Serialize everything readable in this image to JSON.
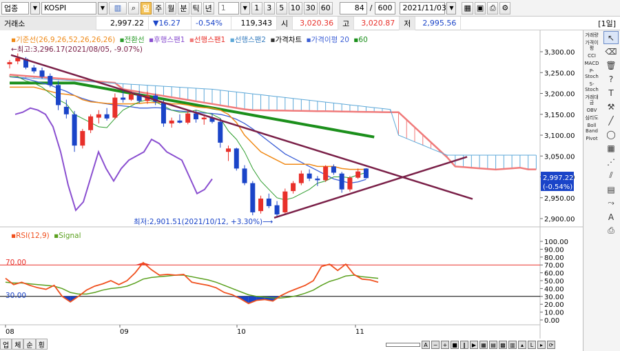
{
  "toolbar": {
    "category": "업종",
    "symbol": "KOSPI",
    "period_buttons": [
      "일",
      "주",
      "월",
      "분",
      "틱",
      "년"
    ],
    "interval_value": "1",
    "interval_buttons": [
      "1",
      "3",
      "5",
      "10",
      "30",
      "60"
    ],
    "display_count": "84",
    "total_count": "600",
    "date": "2021/11/03"
  },
  "infobar": {
    "exchange": "거래소",
    "price": "2,997.22",
    "change": "▼16.27",
    "change_pct": "-0.54%",
    "volume": "119,343",
    "open_label": "시",
    "open": "3,020.36",
    "high_label": "고",
    "high": "3,020.87",
    "low_label": "저",
    "low": "2,995.56",
    "period_badge": "[1일]"
  },
  "main_legend": [
    "기준선(26,9,26,52,26,26,26)",
    "전환선",
    "후행스팬1",
    "선행스팬1",
    "선행스팬2",
    "가격차트",
    "가격이평 20",
    "60"
  ],
  "annotations": {
    "high": "←최고:3,296.17(2021/08/05, -9.07%)",
    "low": "최저:2,901.51(2021/10/12, +3.30%)⟶"
  },
  "price_axis": [
    "3,300.00",
    "3,250.00",
    "3,200.00",
    "3,150.00",
    "3,100.00",
    "3,050.00",
    "3,000.00",
    "2,950.00",
    "2,900.00"
  ],
  "price_tag": {
    "price": "2,997.22",
    "pct": "(-0.54%)"
  },
  "rsi_legend": [
    "RSI(12,9)",
    "Signal"
  ],
  "rsi_levels": {
    "upper": "70.00",
    "lower": "30.00"
  },
  "rsi_axis": [
    "100.00",
    "90.00",
    "80.00",
    "70.00",
    "60.00",
    "50.00",
    "40.00",
    "30.00",
    "20.00",
    "10.00",
    "0.00"
  ],
  "x_axis": [
    "08",
    "09",
    "10",
    "11"
  ],
  "bottom_tabs": [
    "업",
    "체",
    "순",
    "횡"
  ],
  "right_panel": {
    "col1": [
      "거래량",
      "가격이평",
      "CCI",
      "MACD",
      "P-Stoch",
      "S-Stoch",
      "거래대금",
      "OBV",
      "심리도",
      "Boll Band",
      "Pivot"
    ],
    "col2_icons": [
      "cursor-icon",
      "eraser-icon",
      "trash-icon",
      "help-icon",
      "text-tool-icon",
      "fib-tool-icon",
      "line-tool-icon",
      "circle-icon",
      "grid-icon",
      "channel-icon",
      "gann-icon",
      "chart-tool-icon",
      "zigzag-icon",
      "auto-icon",
      "print-icon"
    ]
  },
  "colors": {
    "up": "#e8302a",
    "down": "#1a44c8",
    "kijun": "#f08a17",
    "tenkan": "#2e9d2e",
    "chikou": "#8a4fd0",
    "span1": "#f07a7a",
    "span2": "#5da8d8",
    "ma20": "#3c5fd6",
    "ma60": "#1b8f1b",
    "trend": "#7a2048",
    "rsi": "#f0501e",
    "signal": "#5aa01e"
  },
  "chart_data": {
    "type": "candlestick",
    "date_range": [
      "2021-08-02",
      "2021-11-03"
    ],
    "ylim": [
      2880,
      3320
    ],
    "candles": [
      {
        "o": 3270,
        "h": 3280,
        "l": 3260,
        "c": 3275
      },
      {
        "o": 3277,
        "h": 3296,
        "l": 3270,
        "c": 3285
      },
      {
        "o": 3283,
        "h": 3287,
        "l": 3258,
        "c": 3262
      },
      {
        "o": 3262,
        "h": 3268,
        "l": 3248,
        "c": 3253
      },
      {
        "o": 3255,
        "h": 3262,
        "l": 3235,
        "c": 3240
      },
      {
        "o": 3242,
        "h": 3248,
        "l": 3215,
        "c": 3220
      },
      {
        "o": 3220,
        "h": 3230,
        "l": 3160,
        "c": 3172
      },
      {
        "o": 3168,
        "h": 3185,
        "l": 3140,
        "c": 3150
      },
      {
        "o": 3150,
        "h": 3158,
        "l": 3060,
        "c": 3075
      },
      {
        "o": 3075,
        "h": 3115,
        "l": 3068,
        "c": 3110
      },
      {
        "o": 3112,
        "h": 3150,
        "l": 3105,
        "c": 3145
      },
      {
        "o": 3142,
        "h": 3160,
        "l": 3128,
        "c": 3150
      },
      {
        "o": 3150,
        "h": 3165,
        "l": 3135,
        "c": 3140
      },
      {
        "o": 3142,
        "h": 3200,
        "l": 3138,
        "c": 3190
      },
      {
        "o": 3190,
        "h": 3210,
        "l": 3178,
        "c": 3185
      },
      {
        "o": 3185,
        "h": 3205,
        "l": 3182,
        "c": 3198
      },
      {
        "o": 3198,
        "h": 3206,
        "l": 3176,
        "c": 3182
      },
      {
        "o": 3182,
        "h": 3205,
        "l": 3175,
        "c": 3195
      },
      {
        "o": 3195,
        "h": 3200,
        "l": 3172,
        "c": 3180
      },
      {
        "o": 3178,
        "h": 3185,
        "l": 3120,
        "c": 3128
      },
      {
        "o": 3128,
        "h": 3142,
        "l": 3118,
        "c": 3135
      },
      {
        "o": 3135,
        "h": 3150,
        "l": 3128,
        "c": 3130
      },
      {
        "o": 3130,
        "h": 3158,
        "l": 3126,
        "c": 3152
      },
      {
        "o": 3152,
        "h": 3160,
        "l": 3130,
        "c": 3138
      },
      {
        "o": 3138,
        "h": 3150,
        "l": 3125,
        "c": 3142
      },
      {
        "o": 3142,
        "h": 3152,
        "l": 3128,
        "c": 3132
      },
      {
        "o": 3132,
        "h": 3140,
        "l": 3070,
        "c": 3082
      },
      {
        "o": 3060,
        "h": 3075,
        "l": 3038,
        "c": 3068
      },
      {
        "o": 3068,
        "h": 3070,
        "l": 3015,
        "c": 3020
      },
      {
        "o": 3020,
        "h": 3028,
        "l": 2980,
        "c": 2985
      },
      {
        "o": 2985,
        "h": 2990,
        "l": 2908,
        "c": 2915
      },
      {
        "o": 2918,
        "h": 2955,
        "l": 2912,
        "c": 2948
      },
      {
        "o": 2948,
        "h": 2960,
        "l": 2925,
        "c": 2930
      },
      {
        "o": 2932,
        "h": 2942,
        "l": 2902,
        "c": 2910
      },
      {
        "o": 2915,
        "h": 2972,
        "l": 2910,
        "c": 2965
      },
      {
        "o": 2966,
        "h": 2990,
        "l": 2960,
        "c": 2985
      },
      {
        "o": 2985,
        "h": 3015,
        "l": 2980,
        "c": 3008
      },
      {
        "o": 3008,
        "h": 3018,
        "l": 2990,
        "c": 2996
      },
      {
        "o": 2996,
        "h": 3002,
        "l": 2978,
        "c": 2992
      },
      {
        "o": 2992,
        "h": 3028,
        "l": 2988,
        "c": 3025
      },
      {
        "o": 3025,
        "h": 3030,
        "l": 3005,
        "c": 3010
      },
      {
        "o": 3008,
        "h": 3012,
        "l": 2962,
        "c": 2970
      },
      {
        "o": 2970,
        "h": 3002,
        "l": 2965,
        "c": 2998
      },
      {
        "o": 2998,
        "h": 3020,
        "l": 2995,
        "c": 3013
      },
      {
        "o": 3020,
        "h": 3021,
        "l": 2996,
        "c": 2997
      }
    ],
    "ma20": [
      3240,
      3238,
      3235,
      3230,
      3225,
      3220,
      3212,
      3205,
      3195,
      3188,
      3182,
      3178,
      3175,
      3172,
      3170,
      3168,
      3165,
      3165,
      3166,
      3165,
      3160,
      3158,
      3156,
      3155,
      3153,
      3152,
      3150,
      3145,
      3138,
      3128,
      3115,
      3100,
      3085,
      3070,
      3055,
      3045,
      3035,
      3025,
      3015,
      3005,
      2995,
      2990,
      2985,
      2988,
      2994
    ],
    "rsi": [
      53,
      45,
      48,
      44,
      41,
      39,
      44,
      30,
      23,
      30,
      38,
      43,
      46,
      50,
      45,
      50,
      60,
      73,
      64,
      57,
      58,
      57,
      58,
      48,
      46,
      44,
      41,
      35,
      32,
      27,
      21,
      25,
      26,
      24,
      31,
      36,
      40,
      44,
      50,
      68,
      71,
      63,
      71,
      58,
      52,
      51,
      48
    ],
    "signal": [
      48,
      47,
      47,
      46,
      45,
      44,
      43,
      40,
      35,
      33,
      33,
      35,
      38,
      40,
      41,
      43,
      47,
      52,
      54,
      55,
      56,
      57,
      57,
      55,
      53,
      51,
      48,
      44,
      40,
      36,
      32,
      30,
      29,
      28,
      28,
      29,
      31,
      34,
      38,
      44,
      49,
      52,
      56,
      57,
      55,
      54,
      53
    ]
  }
}
